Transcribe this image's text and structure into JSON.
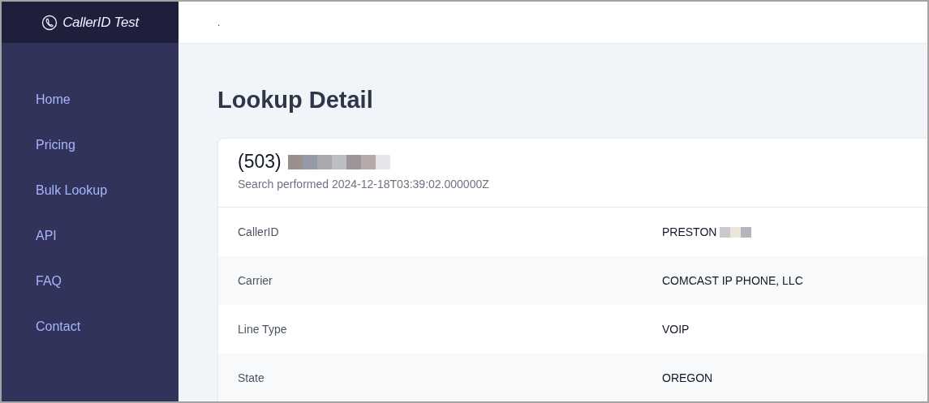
{
  "brand": {
    "title": "CallerID Test"
  },
  "header": {
    "link": "."
  },
  "sidebar": {
    "items": [
      {
        "label": "Home"
      },
      {
        "label": "Pricing"
      },
      {
        "label": "Bulk Lookup"
      },
      {
        "label": "API"
      },
      {
        "label": "FAQ"
      },
      {
        "label": "Contact"
      }
    ]
  },
  "page": {
    "title": "Lookup Detail"
  },
  "card": {
    "number": "(503)",
    "subtitle": "Search performed 2024-12-18T03:39:02.000000Z",
    "rows": [
      {
        "label": "CallerID",
        "value": "PRESTON",
        "redacted": true
      },
      {
        "label": "Carrier",
        "value": "COMCAST IP PHONE, LLC",
        "redacted": false
      },
      {
        "label": "Line Type",
        "value": "VOIP",
        "redacted": false
      },
      {
        "label": "State",
        "value": "OREGON",
        "redacted": false
      }
    ]
  }
}
